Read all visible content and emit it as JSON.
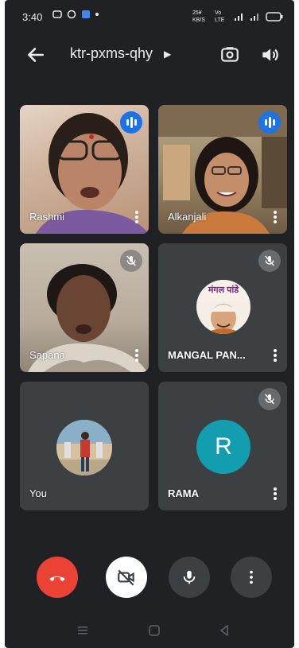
{
  "status": {
    "time": "3:40",
    "speed": "25¥ KB/S",
    "net": "Vo LTE"
  },
  "header": {
    "meeting_code": "ktr-pxms-qhy"
  },
  "tiles": [
    {
      "name": "Rashmi",
      "state": "speaking"
    },
    {
      "name": "Alkanjali",
      "state": "speaking"
    },
    {
      "name": "Sapana",
      "state": "muted"
    },
    {
      "name": "MANGAL PAN...",
      "state": "muted",
      "avatar_text": "मंगल पांडे"
    },
    {
      "name": "You",
      "state": "none"
    },
    {
      "name": "RAMA",
      "state": "muted",
      "initial": "R"
    }
  ],
  "colors": {
    "background": "#202124",
    "tile": "#3c4043",
    "end_call": "#ea4335",
    "speaking": "#1a73e8",
    "avatar_teal": "#129eaf"
  },
  "icons": {
    "back": "arrow-left-icon",
    "switch_camera": "switch-camera-icon",
    "speaker": "volume-icon",
    "end_call": "phone-hangup-icon",
    "camera_off": "video-off-icon",
    "mic": "microphone-icon",
    "more": "more-vert-icon"
  }
}
